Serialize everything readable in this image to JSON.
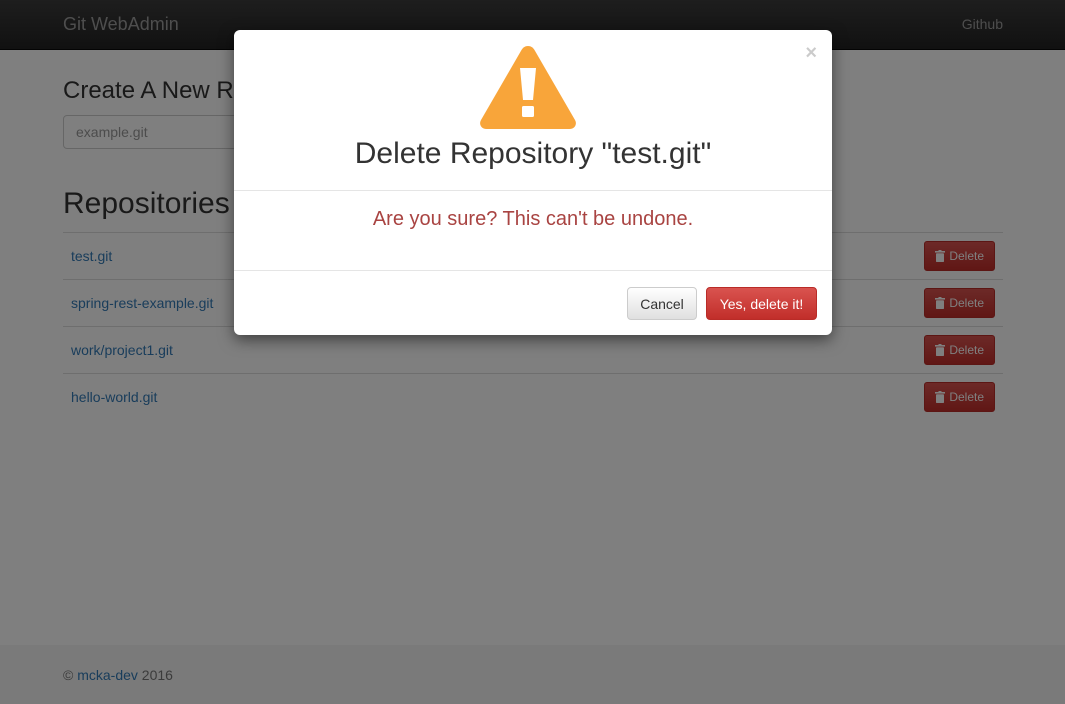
{
  "navbar": {
    "brand": "Git WebAdmin",
    "github_link": "Github"
  },
  "create": {
    "title": "Create A New Repository",
    "placeholder": "example.git"
  },
  "repositories": {
    "title": "Repositories",
    "delete_label": "Delete",
    "items": [
      {
        "name": "test.git"
      },
      {
        "name": "spring-rest-example.git"
      },
      {
        "name": "work/project1.git"
      },
      {
        "name": "hello-world.git"
      }
    ]
  },
  "footer": {
    "copyright": "©",
    "author": "mcka-dev",
    "year": "2016"
  },
  "modal": {
    "icon": "warning-icon",
    "close": "×",
    "title": "Delete Repository \"test.git\"",
    "message": "Are you sure? This can't be undone.",
    "cancel_label": "Cancel",
    "confirm_label": "Yes, delete it!"
  },
  "colors": {
    "danger": "#d9534f",
    "warning": "#f8a53a",
    "link": "#337ab7",
    "message": "#a94442"
  }
}
